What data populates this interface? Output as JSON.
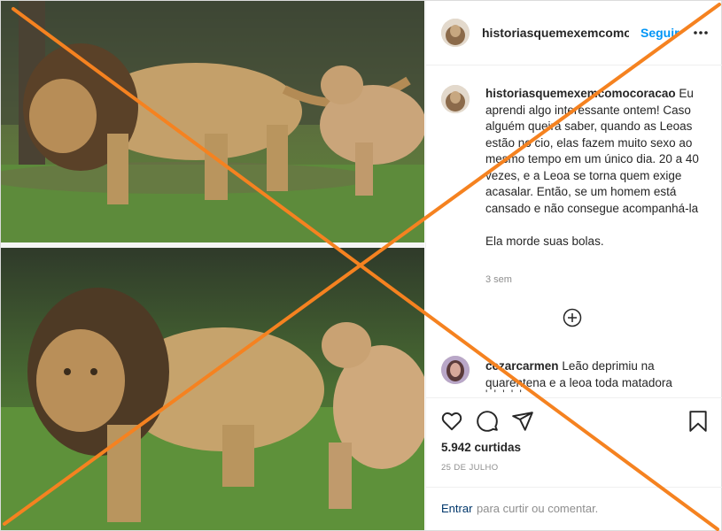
{
  "post": {
    "username": "historiasquemexemcomocoracao",
    "follow_label": "Seguir",
    "more_label": "mais opções"
  },
  "caption": {
    "username": "historiasquemexemcomocoracao",
    "text": "Eu aprendi algo interessante ontem! Caso alguém queira saber, quando as Leoas estão no cio, elas fazem muito sexo ao mesmo tempo em um único dia. 20 a 40 vezes, e a Leoa se torna quem exige acasalar. Então, se um homem está cansado e não consegue acompanhá-la\n\nEla morde suas bolas.",
    "time": "3 sem"
  },
  "comment": {
    "username": "cezarcarmen",
    "text": "Leão deprimiu na quarentena e a leoa toda matadora",
    "fade": "' ' ' ' '"
  },
  "actions": {
    "likes": "5.942 curtidas",
    "date": "25 DE JULHO"
  },
  "footer": {
    "login_link": "Entrar",
    "login_rest": "para curtir ou comentar."
  },
  "colors": {
    "accent": "#0095f6",
    "cross": "#f58220",
    "text": "#262626",
    "muted": "#8e8e8e"
  },
  "icons": [
    "heart-icon",
    "comment-icon",
    "share-icon",
    "bookmark-icon",
    "plus-circle-icon",
    "more-dots-icon"
  ]
}
